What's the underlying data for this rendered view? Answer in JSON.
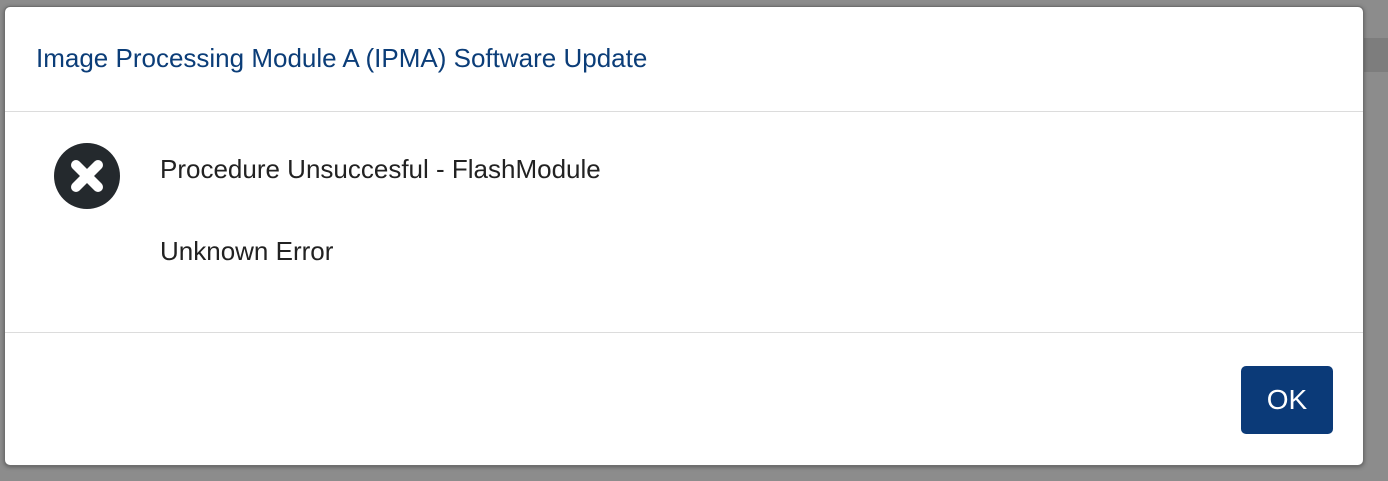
{
  "dialog": {
    "title": "Image Processing Module A (IPMA) Software Update",
    "icon": "error-circle-x-icon",
    "message_primary": "Procedure Unsuccesful - FlashModule",
    "message_secondary": "Unknown Error",
    "ok_label": "OK"
  },
  "colors": {
    "title": "#0b3d78",
    "button_bg": "#0b3a78",
    "button_text": "#ffffff",
    "icon_fill": "#24292d"
  }
}
